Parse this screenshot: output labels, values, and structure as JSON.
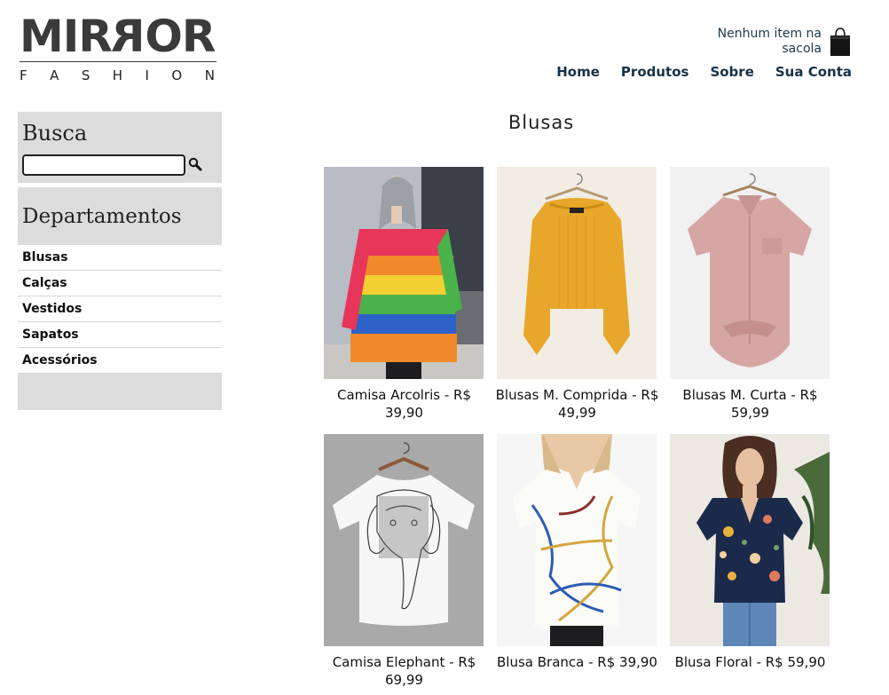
{
  "brand": {
    "logo_main": "MIRROR",
    "logo_letters": [
      "F",
      "A",
      "S",
      "H",
      "I",
      "O",
      "N"
    ]
  },
  "cart": {
    "status": "Nenhum item na sacola",
    "icon": "shopping-bag-icon"
  },
  "nav": [
    "Home",
    "Produtos",
    "Sobre",
    "Sua Conta"
  ],
  "sidebar": {
    "search_title": "Busca",
    "search_value": "",
    "departments_title": "Departamentos",
    "departments": [
      "Blusas",
      "Calças",
      "Vestidos",
      "Sapatos",
      "Acessórios"
    ]
  },
  "main": {
    "title": "Blusas",
    "products": [
      {
        "name": "Camisa Arcolris - R$ 39,90",
        "image": "rainbow-cardigan"
      },
      {
        "name": "Blusas M. Comprida - R$ 49,99",
        "image": "mustard-sweater"
      },
      {
        "name": "Blusas M. Curta - R$ 59,99",
        "image": "pink-shirt"
      },
      {
        "name": "Camisa Elephant - R$ 69,99",
        "image": "elephant-tee"
      },
      {
        "name": "Blusa Branca - R$ 39,90",
        "image": "chain-print-blouse"
      },
      {
        "name": "Blusa Floral - R$ 59,90",
        "image": "floral-blouse"
      }
    ]
  }
}
